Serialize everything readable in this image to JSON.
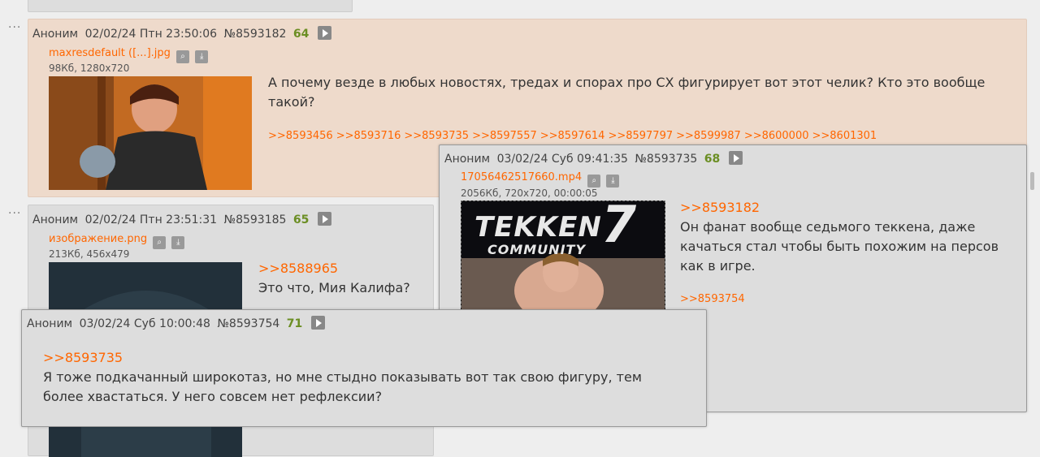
{
  "posts": [
    {
      "author": "Аноним",
      "date": "02/02/24 Птн 23:50:06",
      "id": "№8593182",
      "num": "64",
      "file_name": "maxresdefault ([...].jpg",
      "file_info": "98Кб, 1280x720",
      "text": "А почему везде в любых новостях, тредах и спорах про СХ фигурирует вот этот челик? Кто это вообще такой?",
      "backlinks": [
        ">>8593456",
        ">>8593716",
        ">>8593735",
        ">>8597557",
        ">>8597614",
        ">>8597797",
        ">>8599987",
        ">>8600000",
        ">>8601301"
      ]
    },
    {
      "author": "Аноним",
      "date": "02/02/24 Птн 23:51:31",
      "id": "№8593185",
      "num": "65",
      "file_name": "изображение.png",
      "file_info": "213Кб, 456x479",
      "reply": ">>8588965",
      "text": "Это что, Мия Калифа?"
    }
  ],
  "popups": [
    {
      "author": "Аноним",
      "date": "03/02/24 Суб 09:41:35",
      "id": "№8593735",
      "num": "68",
      "file_name": "17056462517660.mp4",
      "file_info": "2056Кб, 720x720, 00:00:05",
      "thumb_title": "TEKKEN",
      "thumb_num": "7",
      "thumb_sub": "COMMUNITY",
      "reply": ">>8593182",
      "text": "Он фанат вообще седьмого теккена, даже качаться стал чтобы быть похожим на персов как в игре.",
      "backlink": ">>8593754"
    },
    {
      "author": "Аноним",
      "date": "03/02/24 Суб 10:00:48",
      "id": "№8593754",
      "num": "71",
      "reply": ">>8593735",
      "text": "Я тоже подкачанный широкотаз, но мне стыдно показывать вот так свою фигуру, тем более хвастаться. У него совсем нет рефлексии?"
    }
  ],
  "colors": {
    "link": "#ff6600",
    "num": "#6b8e23",
    "post_bg": "#dddddd",
    "highlight_bg": "#eedacb"
  }
}
